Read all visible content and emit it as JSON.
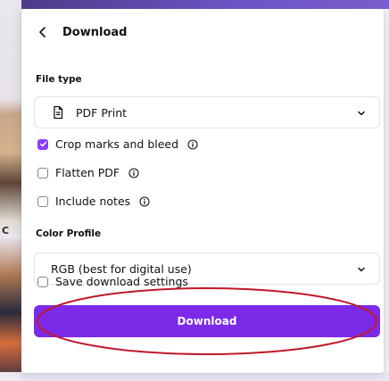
{
  "panel": {
    "title": "Download",
    "file_type_label": "File type",
    "file_type_value": "PDF Print",
    "options": [
      {
        "label": "Crop marks and bleed",
        "checked": true
      },
      {
        "label": "Flatten PDF",
        "checked": false
      },
      {
        "label": "Include notes",
        "checked": false
      }
    ],
    "color_profile_label": "Color Profile",
    "color_profile_value": "RGB (best for digital use)",
    "save_settings_label": "Save download settings",
    "download_button_label": "Download"
  },
  "background": {
    "left_letter": "C"
  },
  "icons": {
    "back": "chevron-left-icon",
    "file": "file-icon",
    "dropdown": "chevron-down-icon",
    "info": "info-icon"
  },
  "colors": {
    "accent": "#7d2ae8",
    "checkbox_checked": "#8b3dff",
    "annotation": "#c0182a"
  }
}
